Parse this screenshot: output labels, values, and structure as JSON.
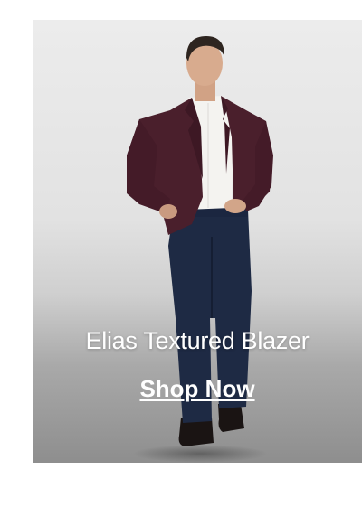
{
  "promo": {
    "title": "Elias Textured Blazer",
    "cta_label": "Shop Now"
  },
  "image": {
    "description_icon": "model-photo",
    "colors": {
      "blazer": "#4a1f2c",
      "shirt": "#f4f3f0",
      "trousers": "#1e2a44",
      "shoes": "#1a1413",
      "background_top": "#ececec",
      "background_bottom": "#8e8e8e",
      "text": "#ffffff"
    }
  }
}
